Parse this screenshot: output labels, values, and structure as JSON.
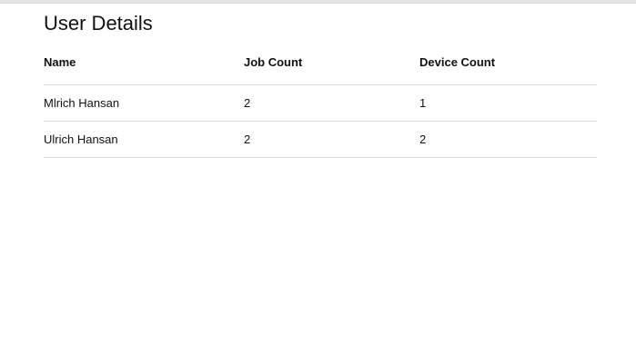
{
  "page": {
    "title": "User Details"
  },
  "table": {
    "headers": {
      "name": "Name",
      "job_count": "Job Count",
      "device_count": "Device Count"
    },
    "rows": [
      {
        "name": "Mlrich Hansan",
        "job_count": "2",
        "device_count": "1"
      },
      {
        "name": "Ulrich Hansan",
        "job_count": "2",
        "device_count": "2"
      }
    ]
  }
}
